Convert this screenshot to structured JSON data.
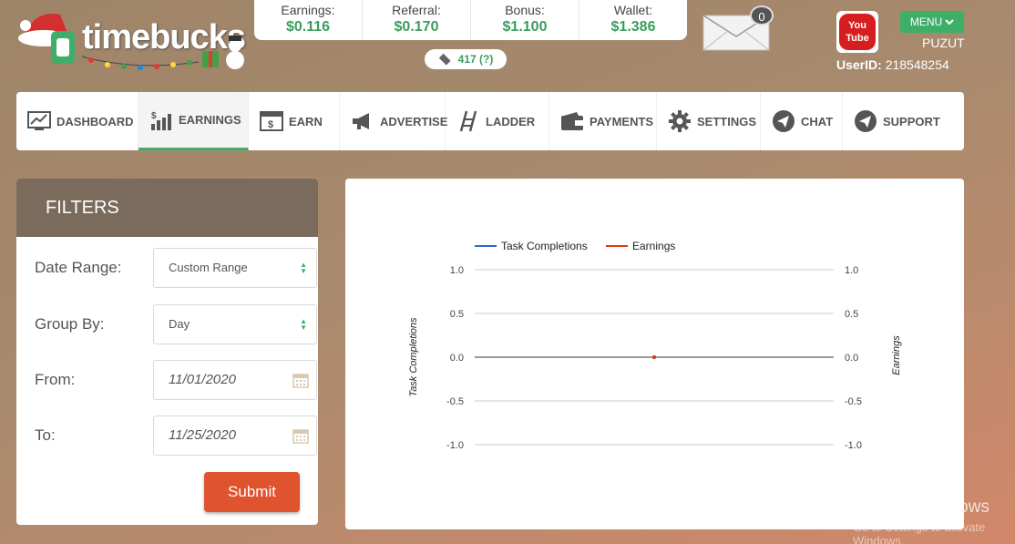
{
  "logo": {
    "text": "timebucks"
  },
  "stats": [
    {
      "label": "Earnings:",
      "value": "$0.116"
    },
    {
      "label": "Referral:",
      "value": "$0.170"
    },
    {
      "label": "Bonus:",
      "value": "$1.100"
    },
    {
      "label": "Wallet:",
      "value": "$1.386"
    }
  ],
  "tickets": {
    "count": "417 (?)"
  },
  "mail": {
    "count": "0"
  },
  "youtube": {
    "line1": "You",
    "line2": "Tube"
  },
  "menu": {
    "label": "MENU"
  },
  "user": {
    "name": "PUZUT",
    "id_label": "UserID:",
    "id_value": "218548254"
  },
  "nav": [
    {
      "label": "DASHBOARD",
      "icon": "dashboard-icon"
    },
    {
      "label": "EARNINGS",
      "icon": "earnings-icon",
      "active": true
    },
    {
      "label": "EARN",
      "icon": "earn-icon"
    },
    {
      "label": "ADVERTISE",
      "icon": "megaphone-icon"
    },
    {
      "label": "LADDER",
      "icon": "ladder-icon"
    },
    {
      "label": "PAYMENTS",
      "icon": "wallet-icon"
    },
    {
      "label": "SETTINGS",
      "icon": "gear-icon"
    },
    {
      "label": "CHAT",
      "icon": "paper-plane-icon"
    },
    {
      "label": "SUPPORT",
      "icon": "paper-plane-icon"
    }
  ],
  "filters": {
    "title": "FILTERS",
    "date_range_label": "Date Range:",
    "date_range_value": "Custom Range",
    "group_by_label": "Group By:",
    "group_by_value": "Day",
    "from_label": "From:",
    "from_value": "11/01/2020",
    "to_label": "To:",
    "to_value": "11/25/2020",
    "submit_label": "Submit"
  },
  "chart_data": {
    "type": "line",
    "title": "",
    "series": [
      {
        "name": "Task Completions",
        "color": "#3366cc",
        "values": [
          0
        ]
      },
      {
        "name": "Earnings",
        "color": "#dc3912",
        "values": [
          0
        ]
      }
    ],
    "ylabel_left": "Task Completions",
    "ylabel_right": "Earnings",
    "ylim": [
      -1.0,
      1.0
    ],
    "yticks": [
      "1.0",
      "0.5",
      "0.0",
      "-0.5",
      "-1.0"
    ],
    "legend_position": "top",
    "grid": true
  },
  "watermark": {
    "line1": "Activate Windows",
    "line2": "Go to Settings to activate Windows."
  }
}
